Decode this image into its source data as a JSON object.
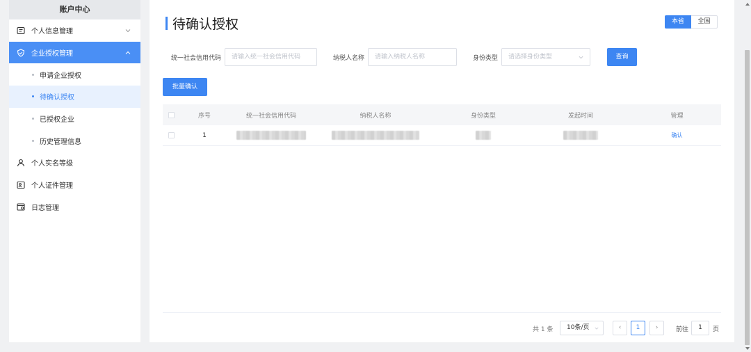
{
  "sidebar": {
    "header": "账户中心",
    "items": [
      {
        "label": "个人信息管理",
        "icon": "profile-card-icon"
      },
      {
        "label": "企业授权管理",
        "icon": "shield-icon",
        "active": true
      },
      {
        "label": "个人实名等级",
        "icon": "user-badge-icon"
      },
      {
        "label": "个人证件管理",
        "icon": "id-card-icon"
      },
      {
        "label": "日志管理",
        "icon": "log-calendar-icon"
      }
    ],
    "subitems": [
      {
        "label": "申请企业授权"
      },
      {
        "label": "待确认授权",
        "current": true
      },
      {
        "label": "已授权企业"
      },
      {
        "label": "历史管理信息"
      }
    ]
  },
  "page": {
    "title": "待确认授权",
    "scope": {
      "province": "本省",
      "national": "全国"
    }
  },
  "filters": {
    "credit_code_label": "统一社会信用代码",
    "credit_code_placeholder": "请输入统一社会信用代码",
    "taxpayer_label": "纳税人名称",
    "taxpayer_placeholder": "请输入纳税人名称",
    "identity_label": "身份类型",
    "identity_placeholder": "请选择身份类型",
    "query_button": "查询"
  },
  "batch_confirm_button": "批量确认",
  "table": {
    "headers": [
      "序号",
      "统一社会信用代码",
      "纳税人名称",
      "身份类型",
      "发起时间",
      "管理"
    ],
    "rows": [
      {
        "index": "1",
        "action": "确认"
      }
    ]
  },
  "pagination": {
    "total": "共 1 条",
    "page_size": "10条/页",
    "prev": "‹",
    "current_page": "1",
    "next": "›",
    "goto_label": "前往",
    "goto_value": "1",
    "goto_unit": "页"
  },
  "colors": {
    "accent": "#3d86f2",
    "sidebar_active": "#4a8ff5",
    "background": "#f0f1f3"
  }
}
